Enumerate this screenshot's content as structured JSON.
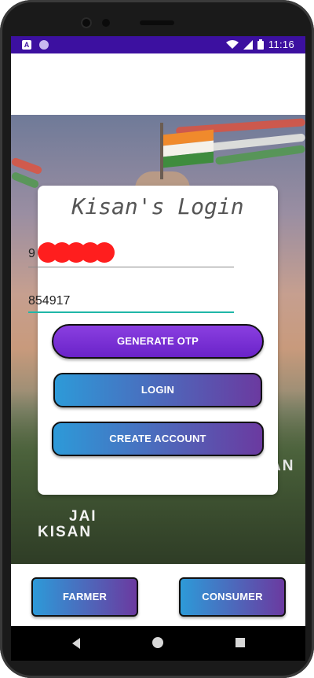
{
  "status_bar": {
    "time": "11:16",
    "left_icons": [
      "notification-a-icon",
      "circle-app-icon"
    ],
    "right_icons": [
      "wifi-icon",
      "signal-icon",
      "battery-icon"
    ],
    "notification_letter": "A",
    "color": "#3c10a0"
  },
  "hero": {
    "overlay_text_jai": "JAI",
    "overlay_text_kisan": "KISAN",
    "overlay_text_an": "AN"
  },
  "login_card": {
    "title": "Kisan's Login",
    "phone_visible_prefix": "9",
    "otp_value": "854917"
  },
  "buttons": {
    "generate_otp": "GENERATE OTP",
    "login": "LOGIN",
    "create_account": "CREATE ACCOUNT",
    "farmer": "FARMER",
    "consumer": "CONSUMER"
  },
  "colors": {
    "primary_purple": "#6a23c9",
    "gradient_start": "#2d9ad8",
    "gradient_end": "#6b3aa0",
    "focus_underline": "#1fb7a8",
    "redaction": "#ff1e1e"
  },
  "nav_bar": {
    "icons": [
      "back-icon",
      "home-icon",
      "recents-icon"
    ]
  }
}
